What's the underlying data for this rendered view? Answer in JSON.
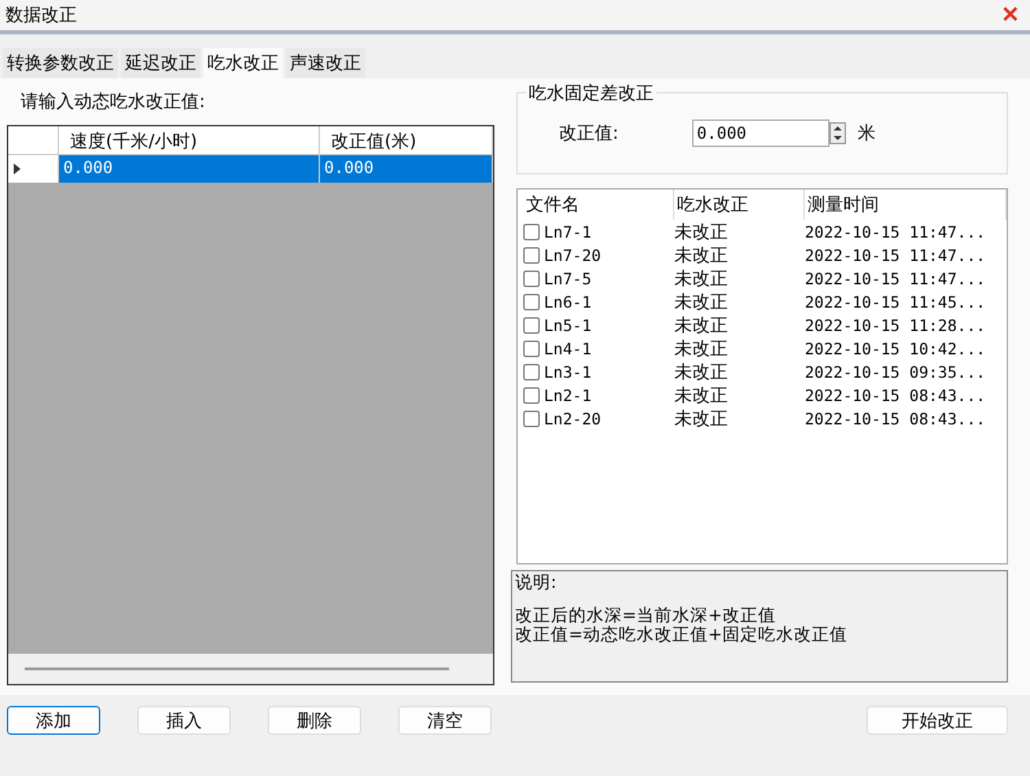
{
  "window": {
    "title": "数据改正",
    "close": "✕"
  },
  "tabs": [
    {
      "label": "转换参数改正",
      "selected": false
    },
    {
      "label": "延迟改正",
      "selected": false
    },
    {
      "label": "吃水改正",
      "selected": true
    },
    {
      "label": "声速改正",
      "selected": false
    }
  ],
  "dynamic": {
    "label": "请输入动态吃水改正值:",
    "columns": [
      "速度(千米/小时)",
      "改正值(米)"
    ],
    "rows": [
      {
        "selected": true,
        "cells": [
          "0.000",
          "0.000"
        ]
      }
    ]
  },
  "fixed": {
    "title": "吃水固定差改正",
    "label": "改正值:",
    "value": "0.000",
    "unit": "米"
  },
  "files": {
    "columns": [
      "文件名",
      "吃水改正",
      "测量时间"
    ],
    "rows": [
      {
        "name": "Ln7-1",
        "checked": false,
        "status": "未改正",
        "time": "2022-10-15 11:47..."
      },
      {
        "name": "Ln7-20",
        "checked": false,
        "status": "未改正",
        "time": "2022-10-15 11:47..."
      },
      {
        "name": "Ln7-5",
        "checked": false,
        "status": "未改正",
        "time": "2022-10-15 11:47..."
      },
      {
        "name": "Ln6-1",
        "checked": false,
        "status": "未改正",
        "time": "2022-10-15 11:45..."
      },
      {
        "name": "Ln5-1",
        "checked": false,
        "status": "未改正",
        "time": "2022-10-15 11:28..."
      },
      {
        "name": "Ln4-1",
        "checked": false,
        "status": "未改正",
        "time": "2022-10-15 10:42..."
      },
      {
        "name": "Ln3-1",
        "checked": false,
        "status": "未改正",
        "time": "2022-10-15 09:35..."
      },
      {
        "name": "Ln2-1",
        "checked": false,
        "status": "未改正",
        "time": "2022-10-15 08:43..."
      },
      {
        "name": "Ln2-20",
        "checked": false,
        "status": "未改正",
        "time": "2022-10-15 08:43..."
      }
    ]
  },
  "note": {
    "title": "说明:",
    "lines": [
      "改正后的水深=当前水深+改正值",
      "改正值=动态吃水改正值+固定吃水改正值"
    ]
  },
  "buttons": [
    {
      "label": "添加",
      "focused": true
    },
    {
      "label": "插入",
      "focused": false
    },
    {
      "label": "删除",
      "focused": false
    },
    {
      "label": "清空",
      "focused": false
    }
  ],
  "start_button": "开始改正"
}
